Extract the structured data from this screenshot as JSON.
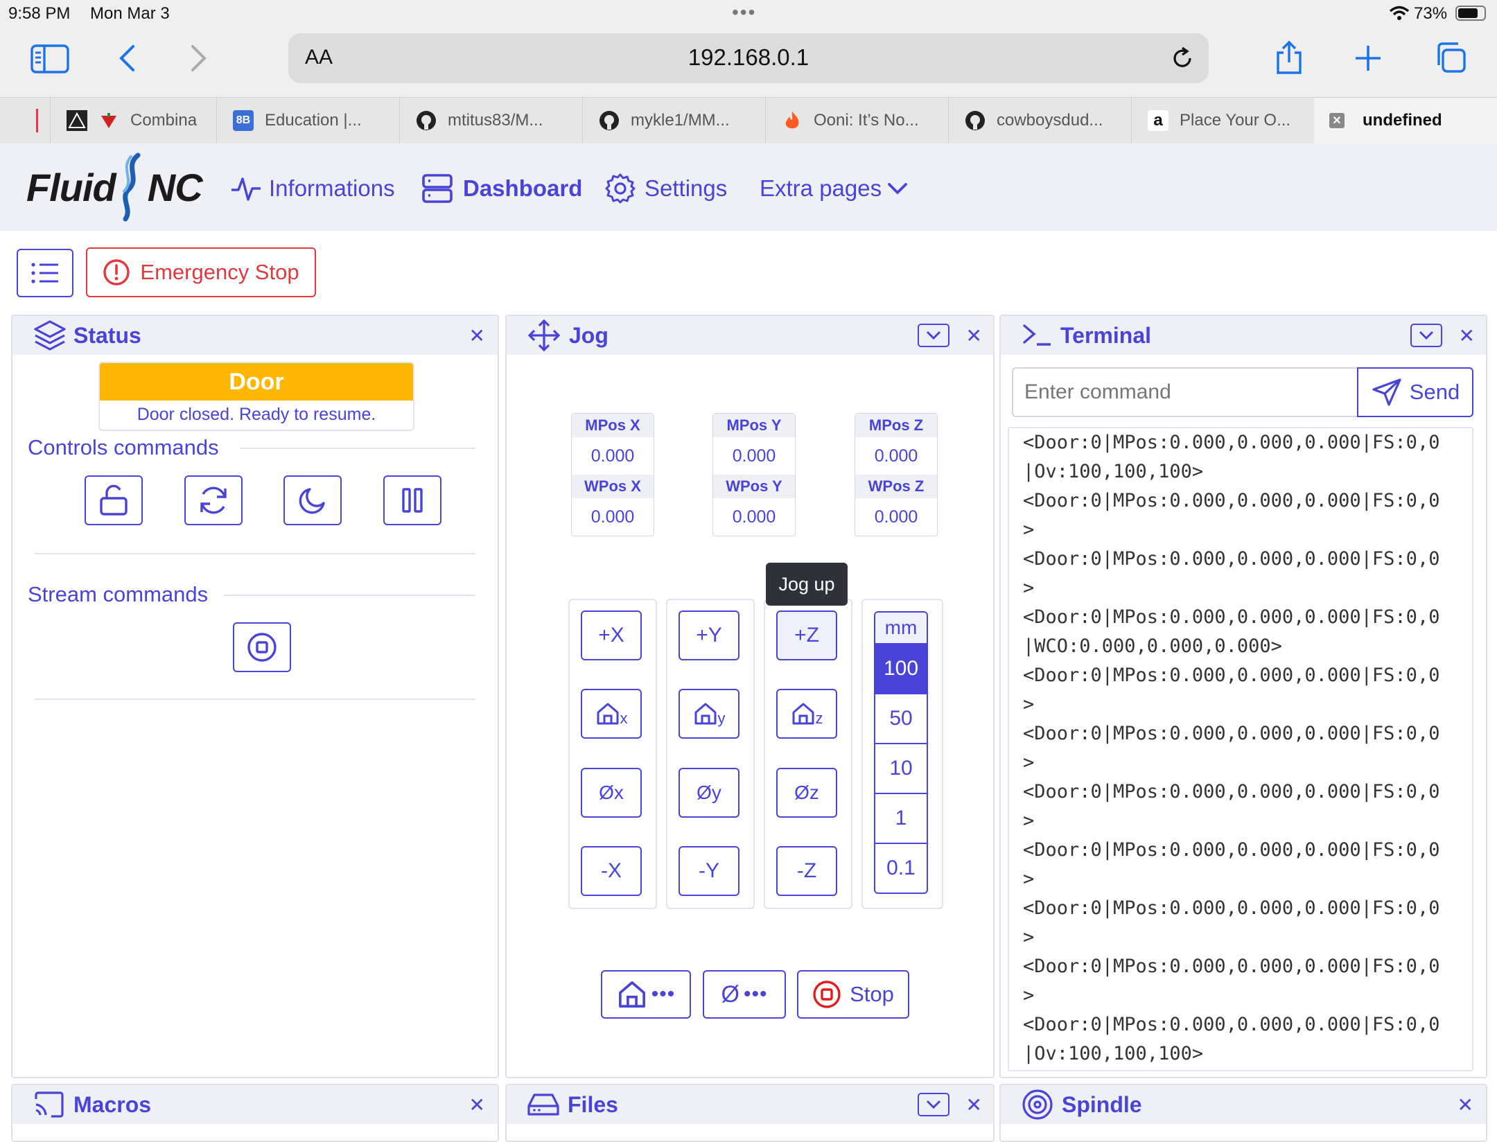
{
  "statusbar": {
    "time": "9:58 PM",
    "date": "Mon Mar 3",
    "battery": "73%"
  },
  "browser": {
    "text_size_label": "AA",
    "url": "192.168.0.1",
    "tabs": [
      {
        "label": ""
      },
      {
        "label": "Combina"
      },
      {
        "label": "Education |..."
      },
      {
        "label": "mtitus83/M..."
      },
      {
        "label": "mykle1/MM..."
      },
      {
        "label": "Ooni: It’s No..."
      },
      {
        "label": "cowboysdud..."
      },
      {
        "label": "Place Your O..."
      },
      {
        "label": "undefined"
      }
    ]
  },
  "app": {
    "logo_left": "Fluid",
    "logo_right": "NC",
    "nav": {
      "informations": "Informations",
      "dashboard": "Dashboard",
      "settings": "Settings",
      "extra": "Extra pages"
    },
    "emergency_stop": "Emergency Stop"
  },
  "status_panel": {
    "title": "Status",
    "state": "Door",
    "state_message": "Door closed. Ready to resume.",
    "controls_title": "Controls commands",
    "stream_title": "Stream commands"
  },
  "jog_panel": {
    "title": "Jog",
    "positions": [
      {
        "mlabel": "MPos X",
        "mvalue": "0.000",
        "wlabel": "WPos X",
        "wvalue": "0.000"
      },
      {
        "mlabel": "MPos Y",
        "mvalue": "0.000",
        "wlabel": "WPos Y",
        "wvalue": "0.000"
      },
      {
        "mlabel": "MPos Z",
        "mvalue": "0.000",
        "wlabel": "WPos Z",
        "wvalue": "0.000"
      }
    ],
    "tooltip": "Jog up",
    "plus": [
      "+X",
      "+Y",
      "+Z"
    ],
    "home_sub": [
      "x",
      "y",
      "z"
    ],
    "zero": [
      "Øx",
      "Øy",
      "Øz"
    ],
    "minus": [
      "-X",
      "-Y",
      "-Z"
    ],
    "unit": "mm",
    "steps": [
      "100",
      "50",
      "10",
      "1",
      "0.1"
    ],
    "selected_step": "100",
    "stop_label": "Stop"
  },
  "terminal_panel": {
    "title": "Terminal",
    "input_placeholder": "Enter command",
    "send_label": "Send",
    "lines": [
      "<Door:0|MPos:0.000,0.000,0.000|FS:0,0",
      "|Ov:100,100,100>",
      "<Door:0|MPos:0.000,0.000,0.000|FS:0,0",
      ">",
      "<Door:0|MPos:0.000,0.000,0.000|FS:0,0",
      ">",
      "<Door:0|MPos:0.000,0.000,0.000|FS:0,0",
      "|WCO:0.000,0.000,0.000>",
      "<Door:0|MPos:0.000,0.000,0.000|FS:0,0",
      ">",
      "<Door:0|MPos:0.000,0.000,0.000|FS:0,0",
      ">",
      "<Door:0|MPos:0.000,0.000,0.000|FS:0,0",
      ">",
      "<Door:0|MPos:0.000,0.000,0.000|FS:0,0",
      ">",
      "<Door:0|MPos:0.000,0.000,0.000|FS:0,0",
      ">",
      "<Door:0|MPos:0.000,0.000,0.000|FS:0,0",
      ">",
      "<Door:0|MPos:0.000,0.000,0.000|FS:0,0",
      "|Ov:100,100,100>"
    ]
  },
  "bottom_panels": {
    "macros": "Macros",
    "files": "Files",
    "spindle": "Spindle"
  },
  "colors": {
    "accent": "#4a43d8",
    "door_state": "#ffb703",
    "danger": "#e0393e",
    "header_bg": "#eff0f6"
  }
}
